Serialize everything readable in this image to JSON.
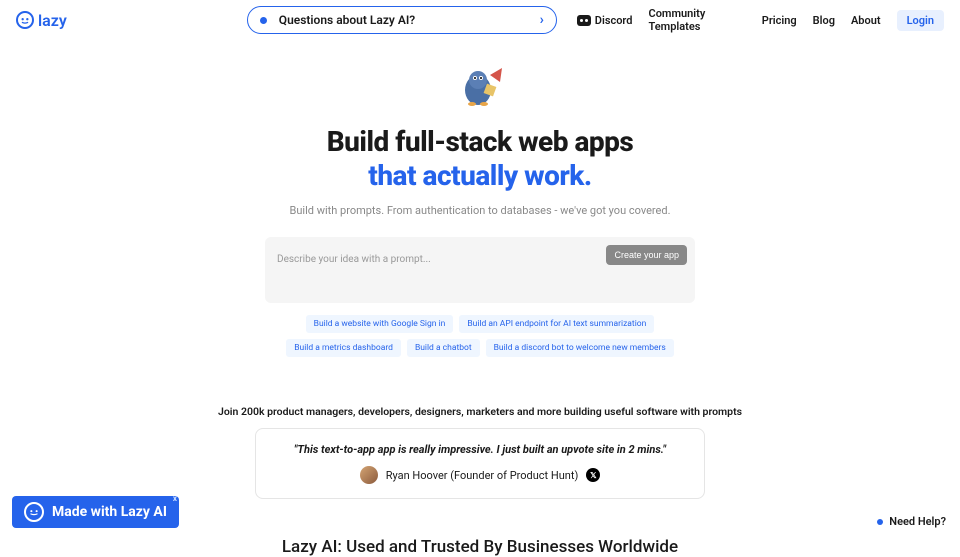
{
  "brand": {
    "name": "lazy"
  },
  "searchPill": {
    "text": "Questions about Lazy AI?"
  },
  "nav": {
    "discord": "Discord",
    "templates": "Community Templates",
    "pricing": "Pricing",
    "blog": "Blog",
    "about": "About",
    "login": "Login"
  },
  "hero": {
    "titleLine1": "Build full-stack web apps",
    "titleLine2": "that actually work.",
    "subtitle": "Build with prompts. From authentication to databases - we've got you covered."
  },
  "prompt": {
    "placeholder": "Describe your idea with a prompt...",
    "cta": "Create your app"
  },
  "chips": [
    "Build a website with Google Sign in",
    "Build an API endpoint for AI text summarization",
    "Build a metrics dashboard",
    "Build a chatbot",
    "Build a discord bot to welcome new members"
  ],
  "joinText": "Join 200k product managers, developers, designers, marketers and more building useful software with prompts",
  "testimonial": {
    "quote": "\"This text-to-app app is really impressive. I just built an upvote site in 2 mins.\"",
    "author": "Ryan Hoover (Founder of Product Hunt)"
  },
  "trusted": "Lazy AI: Used and Trusted By Businesses Worldwide",
  "badge": {
    "text": "Made with Lazy AI",
    "close": "x"
  },
  "help": {
    "text": "Need Help?"
  },
  "colors": {
    "accent": "#2563eb"
  }
}
